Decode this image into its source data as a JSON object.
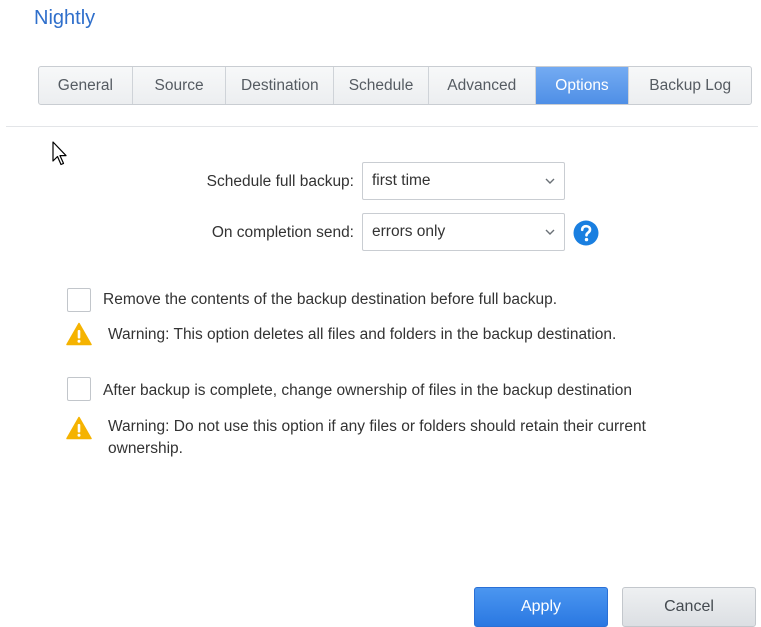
{
  "page": {
    "title": "Nightly"
  },
  "tabs": [
    {
      "label": "General"
    },
    {
      "label": "Source"
    },
    {
      "label": "Destination"
    },
    {
      "label": "Schedule"
    },
    {
      "label": "Advanced"
    },
    {
      "label": "Options",
      "active": true
    },
    {
      "label": "Backup Log"
    }
  ],
  "form": {
    "schedule_full_backup": {
      "label": "Schedule full backup:",
      "value": "first time"
    },
    "on_completion_send": {
      "label": "On completion send:",
      "value": "errors only"
    }
  },
  "options": {
    "remove_contents": {
      "label": "Remove the contents of the backup destination before full backup.",
      "checked": false,
      "warning": "Warning: This option deletes all files and folders in the backup destination."
    },
    "change_ownership": {
      "label": "After backup is complete, change ownership of files in the backup destination",
      "checked": false,
      "warning": "Warning: Do not use this option if any files or folders should retain their current ownership."
    }
  },
  "buttons": {
    "apply": "Apply",
    "cancel": "Cancel"
  },
  "icons": {
    "help": "help-icon",
    "warning": "warning-icon",
    "dropdown": "chevron-down-icon",
    "cursor": "mouse-cursor-icon"
  },
  "colors": {
    "accent": "#2f6fcb",
    "active_tab": "#5f9cec",
    "primary_button": "#3a86ea",
    "warning": "#f5b301",
    "help": "#1a7fe0"
  }
}
